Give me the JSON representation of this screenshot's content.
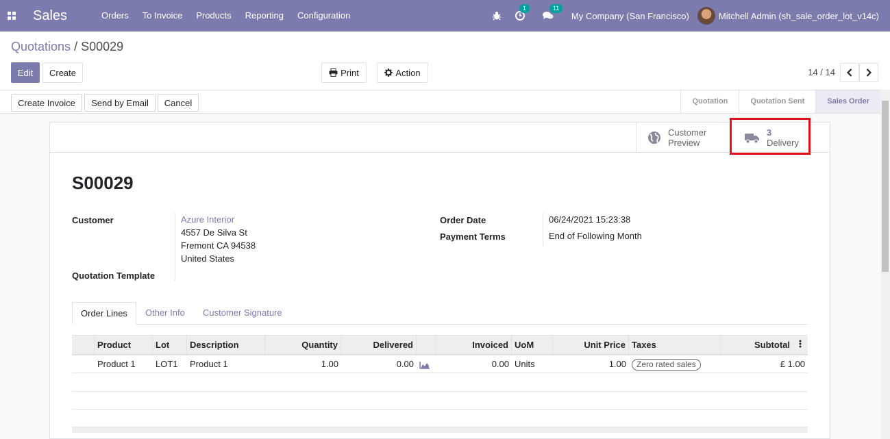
{
  "navbar": {
    "app_name": "Sales",
    "menu": [
      "Orders",
      "To Invoice",
      "Products",
      "Reporting",
      "Configuration"
    ],
    "activity_count": "1",
    "message_count": "11",
    "company": "My Company (San Francisco)",
    "user": "Mitchell Admin (sh_sale_order_lot_v14c)"
  },
  "breadcrumb": {
    "parent": "Quotations",
    "separator": " / ",
    "current": "S00029"
  },
  "controls": {
    "edit": "Edit",
    "create": "Create",
    "print": "Print",
    "action": "Action",
    "pager": "14 / 14"
  },
  "statusbar": {
    "buttons": [
      "Create Invoice",
      "Send by Email",
      "Cancel"
    ],
    "stages": [
      "Quotation",
      "Quotation Sent",
      "Sales Order"
    ],
    "active_stage": "Sales Order"
  },
  "smart_buttons": {
    "preview_line1": "Customer",
    "preview_line2": "Preview",
    "delivery_count": "3",
    "delivery_label": "Delivery"
  },
  "form": {
    "name": "S00029",
    "customer_label": "Customer",
    "customer_name": "Azure Interior",
    "address": [
      "4557 De Silva St",
      "Fremont CA 94538",
      "United States"
    ],
    "template_label": "Quotation Template",
    "order_date_label": "Order Date",
    "order_date": "06/24/2021 15:23:38",
    "payment_terms_label": "Payment Terms",
    "payment_terms": "End of Following Month"
  },
  "tabs": [
    "Order Lines",
    "Other Info",
    "Customer Signature"
  ],
  "table": {
    "headers": [
      "Product",
      "Lot",
      "Description",
      "Quantity",
      "Delivered",
      "Invoiced",
      "UoM",
      "Unit Price",
      "Taxes",
      "Subtotal"
    ],
    "rows": [
      {
        "product": "Product 1",
        "lot": "LOT1",
        "description": "Product 1",
        "quantity": "1.00",
        "delivered": "0.00",
        "invoiced": "0.00",
        "uom": "Units",
        "unit_price": "1.00",
        "taxes": "Zero rated sales",
        "subtotal": "£ 1.00"
      }
    ]
  },
  "colors": {
    "brand": "#7c7bad",
    "highlight": "#e3111b",
    "badge": "#00a09d"
  }
}
